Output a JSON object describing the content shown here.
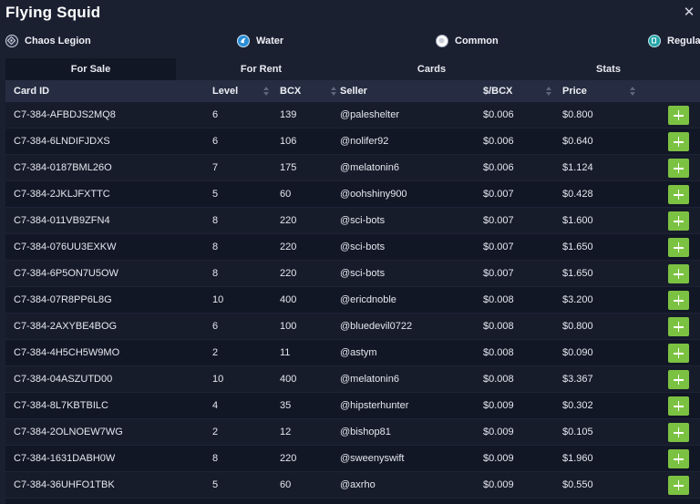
{
  "window": {
    "title": "Flying Squid"
  },
  "attributes": [
    {
      "label": "Chaos Legion",
      "icon": "chaos-legion-icon"
    },
    {
      "label": "Water",
      "icon": "water-icon"
    },
    {
      "label": "Common",
      "icon": "common-rarity-icon"
    },
    {
      "label": "Regular",
      "icon": "regular-foil-icon"
    }
  ],
  "tabs": [
    {
      "label": "For Sale",
      "active": true
    },
    {
      "label": "For Rent",
      "active": false
    },
    {
      "label": "Cards",
      "active": false
    },
    {
      "label": "Stats",
      "active": false
    }
  ],
  "columns": [
    "Card ID",
    "Level",
    "BCX",
    "Seller",
    "$/BCX",
    "Price"
  ],
  "rows": [
    {
      "id": "C7-384-AFBDJS2MQ8",
      "level": "6",
      "bcx": "139",
      "seller": "@paleshelter",
      "per_bcx": "$0.006",
      "price": "$0.800"
    },
    {
      "id": "C7-384-6LNDIFJDXS",
      "level": "6",
      "bcx": "106",
      "seller": "@nolifer92",
      "per_bcx": "$0.006",
      "price": "$0.640"
    },
    {
      "id": "C7-384-0187BML26O",
      "level": "7",
      "bcx": "175",
      "seller": "@melatonin6",
      "per_bcx": "$0.006",
      "price": "$1.124"
    },
    {
      "id": "C7-384-2JKLJFXTTC",
      "level": "5",
      "bcx": "60",
      "seller": "@oohshiny900",
      "per_bcx": "$0.007",
      "price": "$0.428"
    },
    {
      "id": "C7-384-011VB9ZFN4",
      "level": "8",
      "bcx": "220",
      "seller": "@sci-bots",
      "per_bcx": "$0.007",
      "price": "$1.600"
    },
    {
      "id": "C7-384-076UU3EXKW",
      "level": "8",
      "bcx": "220",
      "seller": "@sci-bots",
      "per_bcx": "$0.007",
      "price": "$1.650"
    },
    {
      "id": "C7-384-6P5ON7U5OW",
      "level": "8",
      "bcx": "220",
      "seller": "@sci-bots",
      "per_bcx": "$0.007",
      "price": "$1.650"
    },
    {
      "id": "C7-384-07R8PP6L8G",
      "level": "10",
      "bcx": "400",
      "seller": "@ericdnoble",
      "per_bcx": "$0.008",
      "price": "$3.200"
    },
    {
      "id": "C7-384-2AXYBE4BOG",
      "level": "6",
      "bcx": "100",
      "seller": "@bluedevil0722",
      "per_bcx": "$0.008",
      "price": "$0.800"
    },
    {
      "id": "C7-384-4H5CH5W9MO",
      "level": "2",
      "bcx": "11",
      "seller": "@astym",
      "per_bcx": "$0.008",
      "price": "$0.090"
    },
    {
      "id": "C7-384-04ASZUTD00",
      "level": "10",
      "bcx": "400",
      "seller": "@melatonin6",
      "per_bcx": "$0.008",
      "price": "$3.367"
    },
    {
      "id": "C7-384-8L7KBTBILC",
      "level": "4",
      "bcx": "35",
      "seller": "@hipsterhunter",
      "per_bcx": "$0.009",
      "price": "$0.302"
    },
    {
      "id": "C7-384-2OLNOEW7WG",
      "level": "2",
      "bcx": "12",
      "seller": "@bishop81",
      "per_bcx": "$0.009",
      "price": "$0.105"
    },
    {
      "id": "C7-384-1631DABH0W",
      "level": "8",
      "bcx": "220",
      "seller": "@sweenyswift",
      "per_bcx": "$0.009",
      "price": "$1.960"
    },
    {
      "id": "C7-384-36UHFO1TBK",
      "level": "5",
      "bcx": "60",
      "seller": "@axrho",
      "per_bcx": "$0.009",
      "price": "$0.550"
    }
  ],
  "colors": {
    "accent": "#7cc242",
    "background": "#1b2031",
    "panel": "#121726"
  }
}
